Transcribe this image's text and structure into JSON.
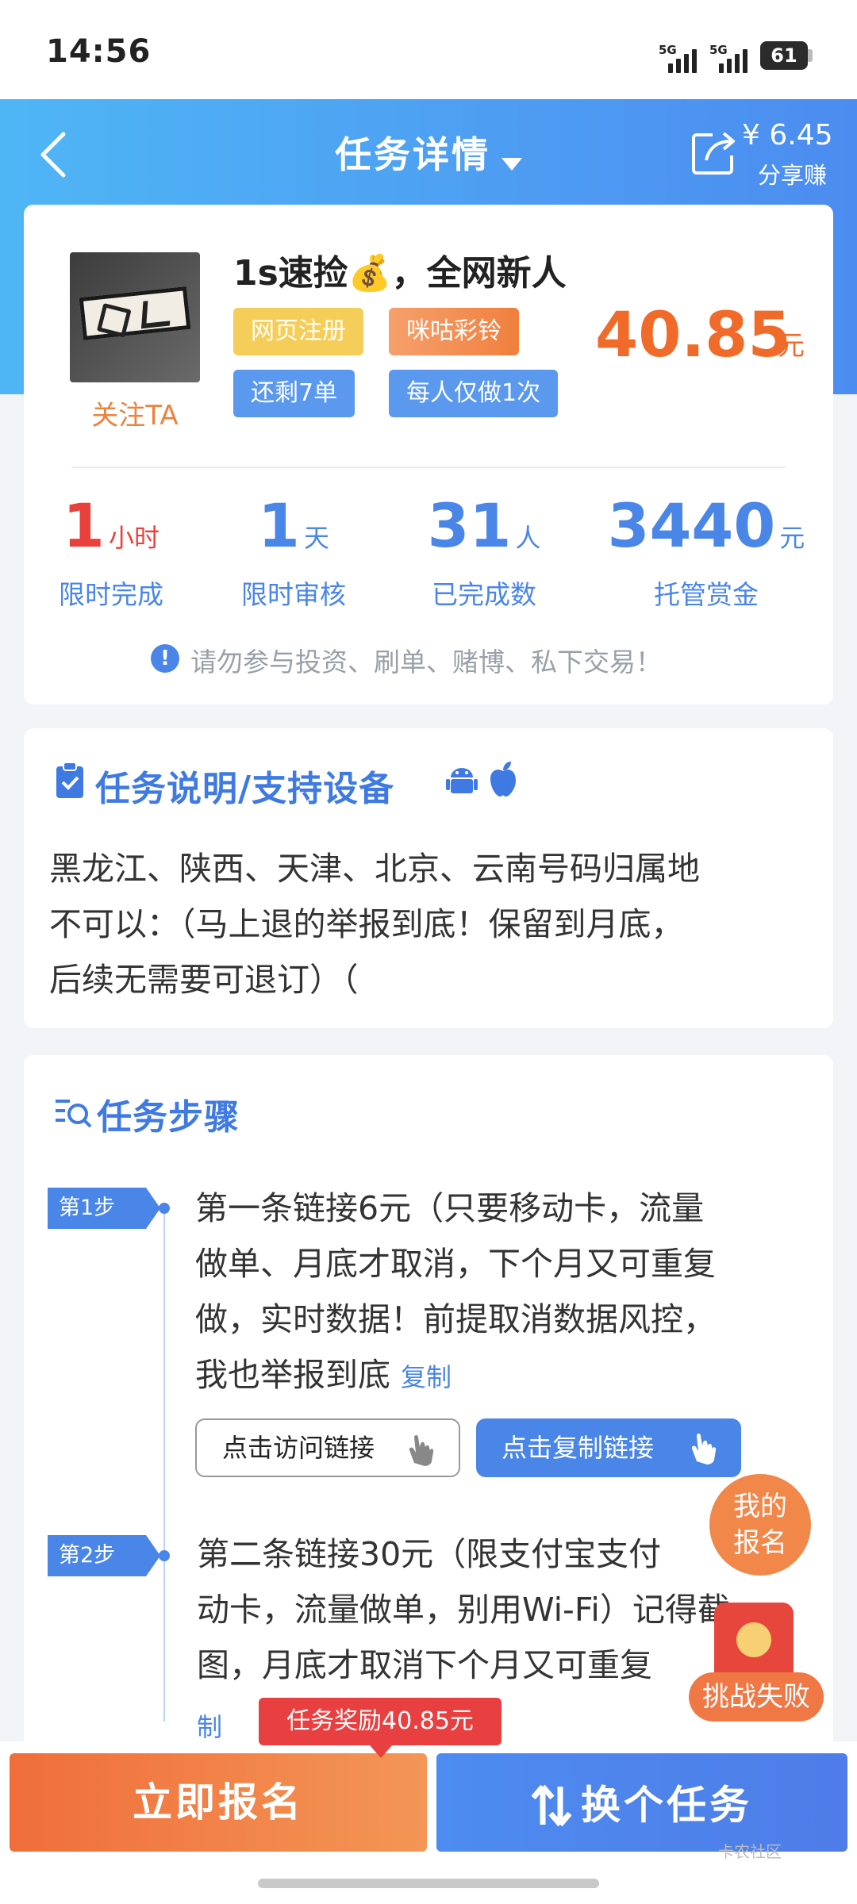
{
  "status": {
    "time": "14:56",
    "signal1": "5G",
    "signal2": "5G",
    "battery": "61"
  },
  "header": {
    "title": "任务详情",
    "share_amount": "¥ 6.45",
    "share_label": "分享赚"
  },
  "task": {
    "name": "1s速捡💰，全网新人",
    "follow_label": "关注TA",
    "tags": [
      "网页注册",
      "咪咕彩铃",
      "还剩7单",
      "每人仅做1次"
    ],
    "price": "40.85",
    "price_unit": "元"
  },
  "stats": [
    {
      "value": "1",
      "unit": "小时",
      "label": "限时完成",
      "color": "#e8403a"
    },
    {
      "value": "1",
      "unit": "天",
      "label": "限时审核",
      "color": "#4a86e8"
    },
    {
      "value": "31",
      "unit": "人",
      "label": "已完成数",
      "color": "#4a86e8"
    },
    {
      "value": "3440",
      "unit": "元",
      "label": "托管赏金",
      "color": "#4a86e8"
    }
  ],
  "warning": "请勿参与投资、刷单、赌博、私下交易！",
  "description": {
    "title": "任务说明/支持设备",
    "lines": [
      "黑龙江、陕西、天津、北京、云南号码归属地",
      "不可以：（马上退的举报到底！保留到月底，",
      "后续无需要可退订）（"
    ]
  },
  "steps": {
    "title": "任务步骤",
    "items": [
      {
        "tag": "第1步",
        "lines": [
          "第一条链接6元（只要移动卡，流量",
          "做单、月底才取消，下个月又可重复",
          "做，实时数据！前提取消数据风控，",
          "我也举报到底"
        ],
        "copy_label": "复制"
      },
      {
        "tag": "第2步",
        "lines": [
          "第二条链接30元（限支付宝支付",
          "动卡，流量做单，别用Wi-Fi）记得截",
          "图，月底才取消下个月又可重复"
        ],
        "copy_label": "制"
      }
    ],
    "visit_button": "点击访问链接",
    "copy_button": "点击复制链接"
  },
  "floating": {
    "my_signup": "我的报名",
    "challenge_fail": "挑战失败"
  },
  "reward_badge": "任务奖励40.85元",
  "bottom": {
    "signup": "立即报名",
    "switch": "换个任务",
    "watermark": "卡农社区"
  }
}
